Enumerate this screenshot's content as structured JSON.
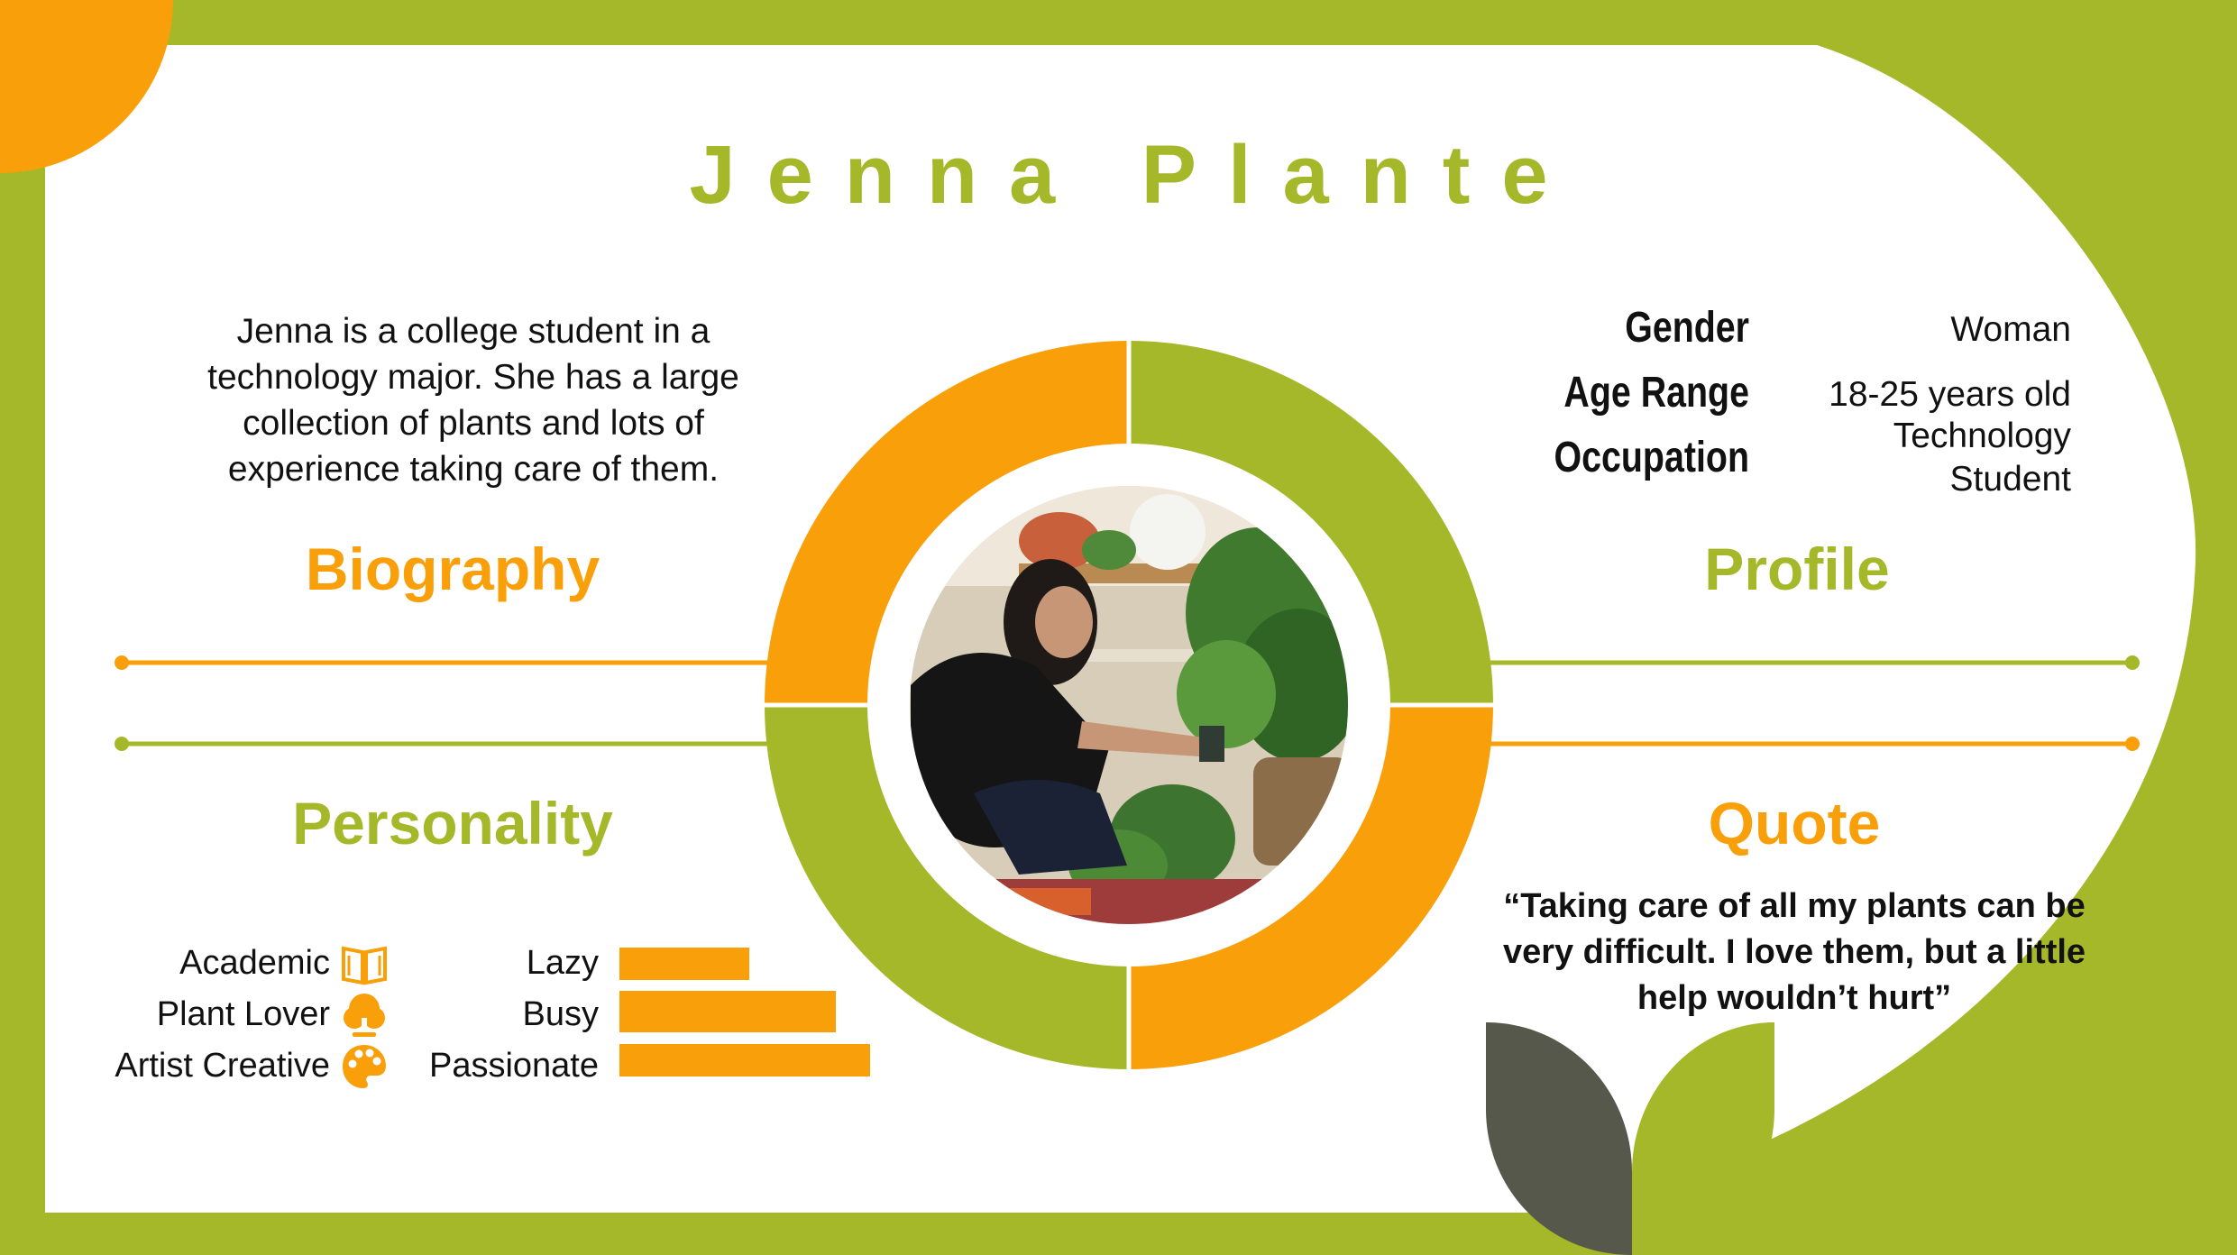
{
  "persona": {
    "name": "Jenna Plante",
    "biography": {
      "heading": "Biography",
      "text": "Jenna is a college student in a technology major. She has a large collection of plants and lots of experience taking care of them."
    },
    "profile": {
      "heading": "Profile",
      "fields": [
        {
          "label": "Gender",
          "value": "Woman"
        },
        {
          "label": "Age Range",
          "value": "18-25 years old"
        },
        {
          "label": "Occupation",
          "value": "Technology Student"
        }
      ]
    },
    "personality": {
      "heading": "Personality",
      "traits": [
        {
          "label": "Academic",
          "icon": "open-book-icon"
        },
        {
          "label": "Plant Lover",
          "icon": "plant-icon"
        },
        {
          "label": "Artist Creative",
          "icon": "palette-icon"
        }
      ],
      "levels": [
        {
          "label": "Lazy",
          "level": 0.6
        },
        {
          "label": "Busy",
          "level": 1.0
        },
        {
          "label": "Passionate",
          "level": 1.16
        }
      ]
    },
    "quote": {
      "heading": "Quote",
      "text": "“Taking care of all my plants can be very difficult. I love them, but a little help wouldn’t hurt”"
    },
    "photo": {
      "icon": "persona-photo"
    }
  },
  "colors": {
    "green": "#a4b82a",
    "orange": "#f99f0a",
    "dark_leaf": "#55584a",
    "text": "#111111"
  }
}
